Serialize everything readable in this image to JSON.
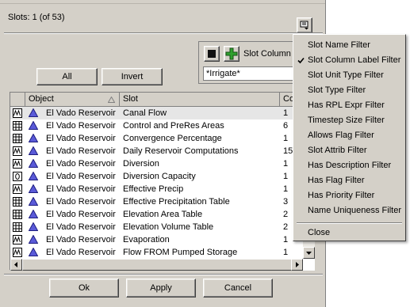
{
  "slots_label": "Slots: 1 (of 53)",
  "buttons": {
    "all": "All",
    "invert": "Invert",
    "ok": "Ok",
    "apply": "Apply",
    "cancel": "Cancel"
  },
  "filter": {
    "label": "Slot Column La",
    "value": "*Irrigate*"
  },
  "table": {
    "columns": [
      "Object",
      "Slot",
      "Co"
    ],
    "rows": [
      {
        "icon": "series-icon",
        "object": "El Vado Reservoir",
        "slot": "Canal Flow",
        "count": "1"
      },
      {
        "icon": "table-icon",
        "object": "El Vado Reservoir",
        "slot": "Control and PreRes Areas",
        "count": "6"
      },
      {
        "icon": "table-icon",
        "object": "El Vado Reservoir",
        "slot": "Convergence Percentage",
        "count": "1"
      },
      {
        "icon": "series-icon",
        "object": "El Vado Reservoir",
        "slot": "Daily Reservoir Computations",
        "count": "15"
      },
      {
        "icon": "series-icon",
        "object": "El Vado Reservoir",
        "slot": "Diversion",
        "count": "1"
      },
      {
        "icon": "scalar-icon",
        "object": "El Vado Reservoir",
        "slot": "Diversion Capacity",
        "count": "1"
      },
      {
        "icon": "series-icon",
        "object": "El Vado Reservoir",
        "slot": "Effective Precip",
        "count": "1"
      },
      {
        "icon": "table-icon",
        "object": "El Vado Reservoir",
        "slot": "Effective Precipitation Table",
        "count": "3"
      },
      {
        "icon": "table-icon",
        "object": "El Vado Reservoir",
        "slot": "Elevation Area Table",
        "count": "2"
      },
      {
        "icon": "table-icon",
        "object": "El Vado Reservoir",
        "slot": "Elevation Volume Table",
        "count": "2"
      },
      {
        "icon": "series-icon",
        "object": "El Vado Reservoir",
        "slot": "Evaporation",
        "count": "1"
      },
      {
        "icon": "series-icon",
        "object": "El Vado Reservoir",
        "slot": "Flow FROM Pumped Storage",
        "count": "1"
      }
    ]
  },
  "menu": {
    "items": [
      {
        "label": "Slot Name Filter",
        "checked": false
      },
      {
        "label": "Slot Column Label Filter",
        "checked": true
      },
      {
        "label": "Slot Unit Type Filter",
        "checked": false
      },
      {
        "label": "Slot Type Filter",
        "checked": false
      },
      {
        "label": "Has RPL Expr Filter",
        "checked": false
      },
      {
        "label": "Timestep Size Filter",
        "checked": false
      },
      {
        "label": "Allows Flag Filter",
        "checked": false
      },
      {
        "label": "Slot Attrib Filter",
        "checked": false
      },
      {
        "label": "Has Description Filter",
        "checked": false
      },
      {
        "label": "Has Flag Filter",
        "checked": false
      },
      {
        "label": "Has Priority Filter",
        "checked": false
      },
      {
        "label": "Name Uniqueness Filter",
        "checked": false
      }
    ],
    "close": "Close"
  },
  "colors": {
    "panel": "#d4d0c8",
    "selected_row": "#e6e6e6",
    "add_icon": "#2fa02f",
    "reservoir_icon": "#5a5ad8"
  }
}
